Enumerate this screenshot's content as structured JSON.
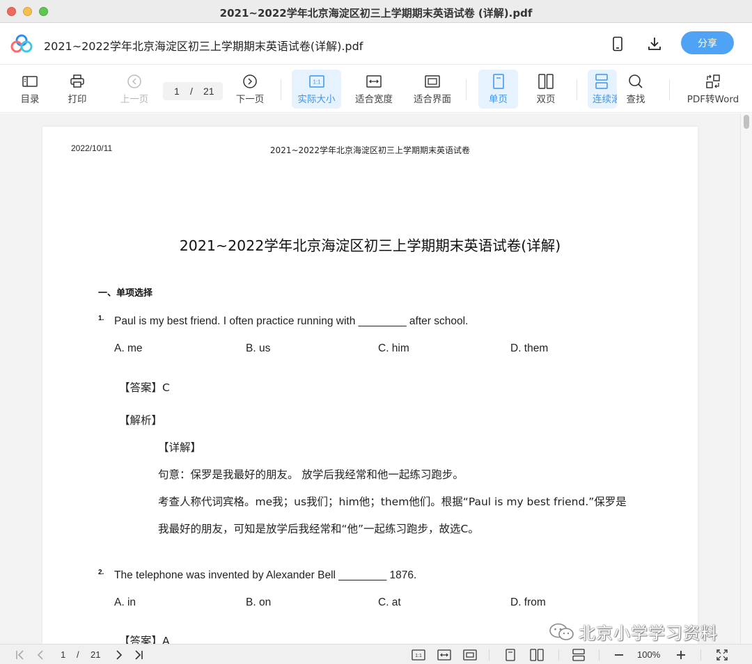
{
  "window": {
    "title": "2021~2022学年北京海淀区初三上学期期末英语试卷 (详解).pdf"
  },
  "header": {
    "doc_title": "2021~2022学年北京海淀区初三上学期期末英语试卷(详解).pdf",
    "share_label": "分享"
  },
  "toolbar": {
    "toc": "目录",
    "print": "打印",
    "prev": "上一页",
    "page_current": "1",
    "page_sep": "/",
    "page_total": "21",
    "next": "下一页",
    "actual_size": "实际大小",
    "fit_width": "适合宽度",
    "fit_screen": "适合界面",
    "single_page": "单页",
    "double_page": "双页",
    "continuous": "连续滚动",
    "find": "查找",
    "pdf_to_word": "PDF转Word",
    "actual_size_glyph": "1:1"
  },
  "page": {
    "date": "2022/10/11",
    "running_header": "2021~2022学年北京海淀区初三上学期期末英语试卷",
    "title": "2021~2022学年北京海淀区初三上学期期末英语试卷(详解)",
    "section": "一、单项选择",
    "questions": [
      {
        "number": "1.",
        "text": "Paul is my best friend. I often practice running with ________ after school.",
        "options": [
          "A. me",
          "B. us",
          "C. him",
          "D. them"
        ],
        "answer": "【答案】C",
        "analysis_label": "【解析】",
        "detail_label": "【详解】",
        "detail_lines": [
          "句意：保罗是我最好的朋友。 放学后我经常和他一起练习跑步。",
          "考查人称代词宾格。me我；us我们；him他；them他们。根据“Paul is my best friend.”保罗是",
          "我最好的朋友，可知是放学后我经常和“他”一起练习跑步，故选C。"
        ]
      },
      {
        "number": "2.",
        "text": "The telephone was invented by Alexander Bell ________ 1876.",
        "options": [
          "A. in",
          "B. on",
          "C. at",
          "D. from"
        ],
        "answer": "【答案】A"
      }
    ]
  },
  "statusbar": {
    "page_current": "1",
    "page_sep": "/",
    "page_total": "21",
    "zoom": "100%",
    "actual_size_glyph": "1:1"
  },
  "watermark": {
    "text": "北京小学学习资料"
  },
  "colors": {
    "accent": "#4ea3f4",
    "active_bg": "#e6f2fd",
    "active_text": "#3d95ee"
  }
}
